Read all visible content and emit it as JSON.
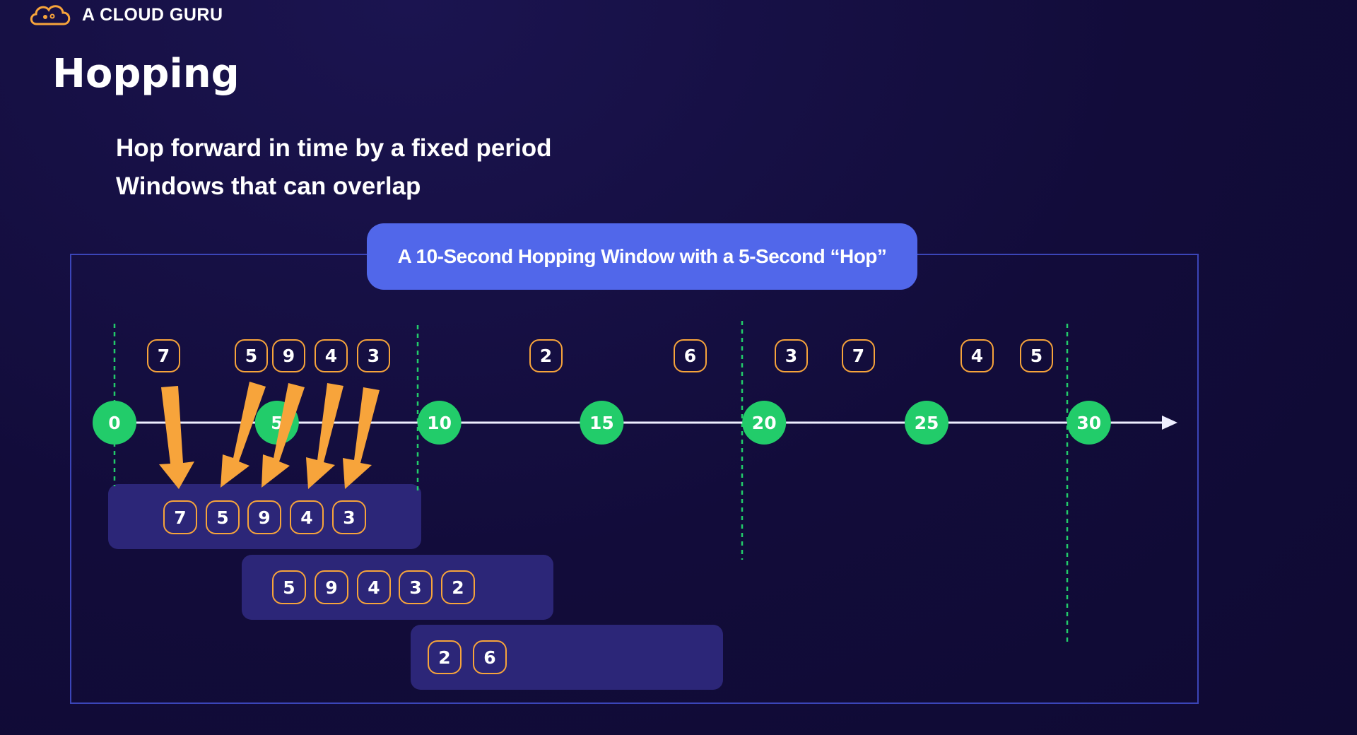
{
  "header": {
    "brand": "A CLOUD GURU",
    "brand_icon": "cloud-icon",
    "brand_color": "#f7a43b"
  },
  "slide": {
    "title": "Hopping",
    "bullets": [
      "Hop forward in time by a fixed period",
      "Windows that can overlap"
    ]
  },
  "diagram": {
    "banner": "A 10-Second Hopping Window with a 5-Second “Hop”",
    "timeline_ticks": [
      "0",
      "5",
      "10",
      "15",
      "20",
      "25",
      "30"
    ],
    "events": [
      {
        "value": "7",
        "time": 2.4
      },
      {
        "value": "5",
        "time": 4.3
      },
      {
        "value": "9",
        "time": 5.7
      },
      {
        "value": "4",
        "time": 7.1
      },
      {
        "value": "3",
        "time": 8.5
      },
      {
        "value": "2",
        "time": 14.3
      },
      {
        "value": "6",
        "time": 18.8
      },
      {
        "value": "3",
        "time": 21.5
      },
      {
        "value": "7",
        "time": 23.6
      },
      {
        "value": "4",
        "time": 27.3
      },
      {
        "value": "5",
        "time": 29.1
      }
    ],
    "windows": [
      {
        "values": [
          "7",
          "5",
          "9",
          "4",
          "3"
        ]
      },
      {
        "values": [
          "5",
          "9",
          "4",
          "3",
          "2"
        ]
      },
      {
        "values": [
          "2",
          "6"
        ]
      }
    ],
    "colors": {
      "tick": "#22cc6a",
      "event_border": "#f7a43b",
      "arrow": "#f7a43b",
      "banner": "#5167ea",
      "window": "#2c2678",
      "frame": "#3b45b8",
      "dashed": "#22cc6a"
    }
  }
}
